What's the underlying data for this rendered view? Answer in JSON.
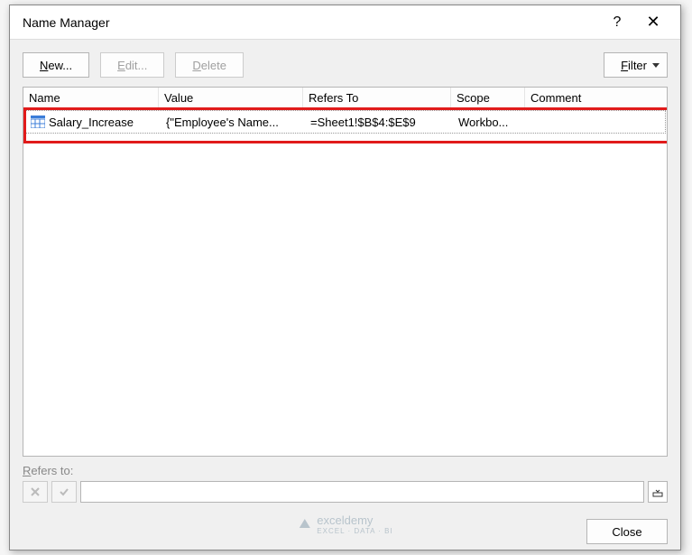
{
  "dialog": {
    "title": "Name Manager",
    "help": "?",
    "close": "✕"
  },
  "buttons": {
    "new": "New...",
    "edit": "Edit...",
    "delete": "Delete",
    "filter": "Filter",
    "close": "Close"
  },
  "headers": {
    "name": "Name",
    "value": "Value",
    "refers": "Refers To",
    "scope": "Scope",
    "comment": "Comment"
  },
  "row": {
    "name": "Salary_Increase",
    "value": "{\"Employee's Name...",
    "refers": "=Sheet1!$B$4:$E$9",
    "scope": "Workbo...",
    "comment": ""
  },
  "refers_label": "Refers to:",
  "refers_input": "",
  "watermark": {
    "brand": "exceldemy",
    "sub": "EXCEL · DATA · BI"
  }
}
